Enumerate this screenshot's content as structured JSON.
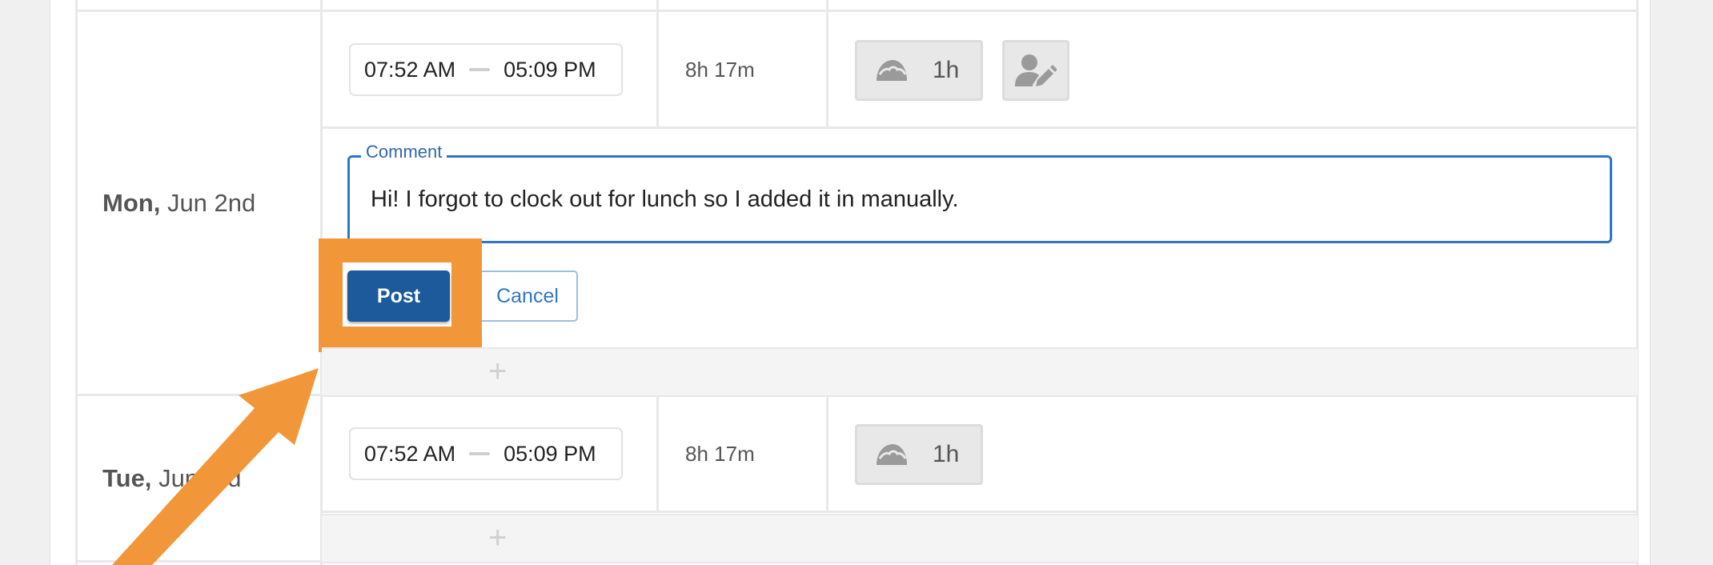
{
  "days": [
    {
      "weekday": "Mon,",
      "date": "Jun 2nd",
      "time_in": "07:52 AM",
      "time_out": "05:09 PM",
      "duration": "8h 17m",
      "break_label": "1h",
      "break_icon": "taco-icon",
      "edit_icon": "user-edit-icon"
    },
    {
      "weekday": "Tue,",
      "date": "Jun 3rd",
      "time_in": "07:52 AM",
      "time_out": "05:09 PM",
      "duration": "8h 17m",
      "break_label": "1h",
      "break_icon": "taco-icon"
    }
  ],
  "comment": {
    "legend": "Comment",
    "value": "Hi! I forgot to clock out for lunch so I added it in manually."
  },
  "buttons": {
    "post": "Post",
    "cancel": "Cancel"
  },
  "add_row_symbol": "+",
  "colors": {
    "accent": "#2f77c4",
    "post_button": "#1c5a9b",
    "highlight": "#f2963a"
  }
}
